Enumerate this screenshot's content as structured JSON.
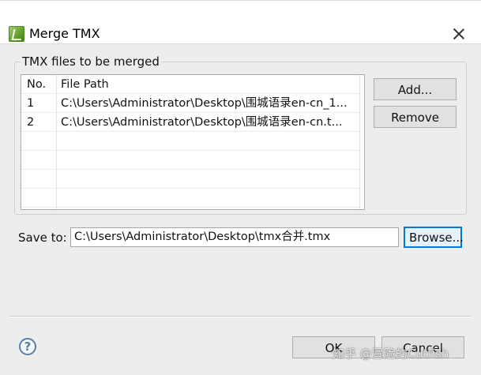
{
  "window": {
    "title": "Merge TMX",
    "icon": "app-icon",
    "close_icon": "close-icon"
  },
  "files_group": {
    "legend": "TMX files to be merged",
    "columns": [
      "No.",
      "File Path"
    ],
    "rows": [
      {
        "no": "1",
        "path": "C:\\Users\\Administrator\\Desktop\\围城语录en-cn_1..."
      },
      {
        "no": "2",
        "path": "C:\\Users\\Administrator\\Desktop\\围城语录en-cn.t..."
      }
    ],
    "add_label": "Add...",
    "remove_label": "Remove"
  },
  "save": {
    "label": "Save to:",
    "value": "C:\\Users\\Administrator\\Desktop\\tmx合并.tmx",
    "browse_label": "Browse..."
  },
  "footer": {
    "help_icon": "question-icon",
    "ok_label": "OK",
    "cancel_label": "Cancel"
  },
  "watermark": "知乎 @冒险的Cutfish",
  "colors": {
    "accent": "#0078d7",
    "dialog_bg": "#ededed"
  }
}
